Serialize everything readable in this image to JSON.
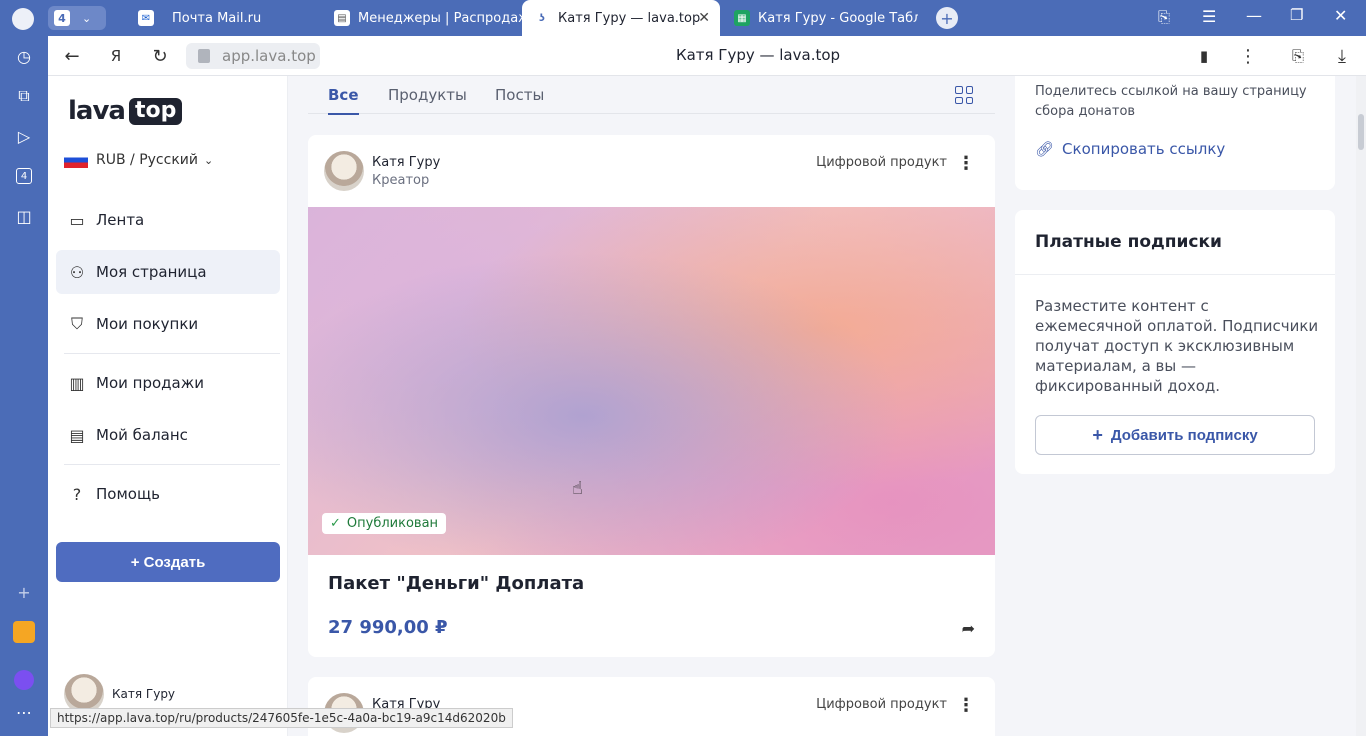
{
  "browser": {
    "tab_count_badge": "4",
    "tabs": [
      {
        "label": "Почта Mail.ru",
        "icon": "mail-icon"
      },
      {
        "label": "Менеджеры | Распродажа",
        "icon": "doc-icon"
      },
      {
        "label": "Катя Гуру — lava.top",
        "icon": "lava-icon",
        "active": true
      },
      {
        "label": "Катя Гуру - Google Табли",
        "icon": "sheets-icon"
      }
    ],
    "url": "app.lava.top",
    "page_title": "Катя Гуру — lava.top",
    "status_url": "https://app.lava.top/ru/products/247605fe-1e5c-4a0a-bc19-a9c14d62020b",
    "side_badge": "4"
  },
  "sidebar": {
    "logo_left": "lava",
    "logo_right": "top",
    "language": "RUB / Русский",
    "items": [
      {
        "label": "Лента",
        "icon": "feed-icon"
      },
      {
        "label": "Моя страница",
        "icon": "user-icon",
        "active": true
      },
      {
        "label": "Мои покупки",
        "icon": "bag-icon"
      },
      {
        "label": "Мои продажи",
        "icon": "chart-icon"
      },
      {
        "label": "Мой баланс",
        "icon": "card-icon"
      },
      {
        "label": "Помощь",
        "icon": "help-icon"
      }
    ],
    "create_label": "+ Создать",
    "user_name": "Катя Гуру"
  },
  "filters": {
    "tabs": [
      "Все",
      "Продукты",
      "Посты"
    ],
    "active": "Все"
  },
  "posts": [
    {
      "author": "Катя Гуру",
      "role": "Креатор",
      "type": "Цифровой продукт",
      "status": "Опубликован",
      "title": "Пакет \"Деньги\" Доплата",
      "price": "27 990,00 ₽"
    },
    {
      "author": "Катя Гуру",
      "type": "Цифровой продукт"
    }
  ],
  "right": {
    "donate_text": "Поделитесь ссылкой на вашу страницу сбора донатов",
    "copy_link": "Скопировать ссылку",
    "subs_title": "Платные подписки",
    "subs_text": "Разместите контент с ежемесячной оплатой. Подписчики получат доступ к эксклюзивным материалам, а вы — фиксированный доход.",
    "add_sub": "Добавить подписку"
  },
  "colors": {
    "accent": "#4f6cc0",
    "browser": "#4b6cb7",
    "price": "#3a57a8",
    "published": "#2b9a4b"
  }
}
